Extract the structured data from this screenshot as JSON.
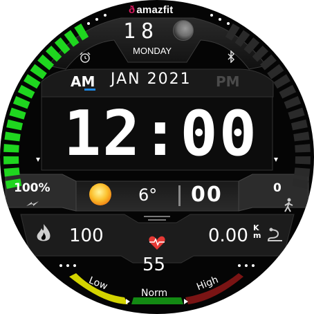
{
  "brand": {
    "logo": "ð",
    "name": "amazfit"
  },
  "date": {
    "day": "18",
    "weekday": "MONDAY",
    "month_year": "JAN 2021"
  },
  "ampm": {
    "am": "AM",
    "pm": "PM",
    "active": "AM"
  },
  "time": {
    "value": "12:00"
  },
  "battery": {
    "percent": "100%"
  },
  "weather": {
    "temp": "6°"
  },
  "heart_big": {
    "value": "00"
  },
  "steps": {
    "value": "0"
  },
  "calories": {
    "value": "100"
  },
  "distance": {
    "value": "0.00",
    "unit_top": "K",
    "unit_bottom": "m"
  },
  "heart_rate": {
    "value": "55"
  },
  "zones": {
    "low": "Low",
    "norm": "Norm",
    "high": "High"
  },
  "colors": {
    "accent": "#1e88e5",
    "battery_bar": "#1fd61f",
    "low": "#e6e600",
    "norm": "#1fa11f",
    "high": "#8b1a1a"
  },
  "icons": [
    "alarm-icon",
    "bluetooth-icon",
    "moon-icon",
    "sun-icon",
    "lightning-icon",
    "walk-icon",
    "flame-icon",
    "heart-icon",
    "distance-icon"
  ],
  "battery_level": 1.0
}
